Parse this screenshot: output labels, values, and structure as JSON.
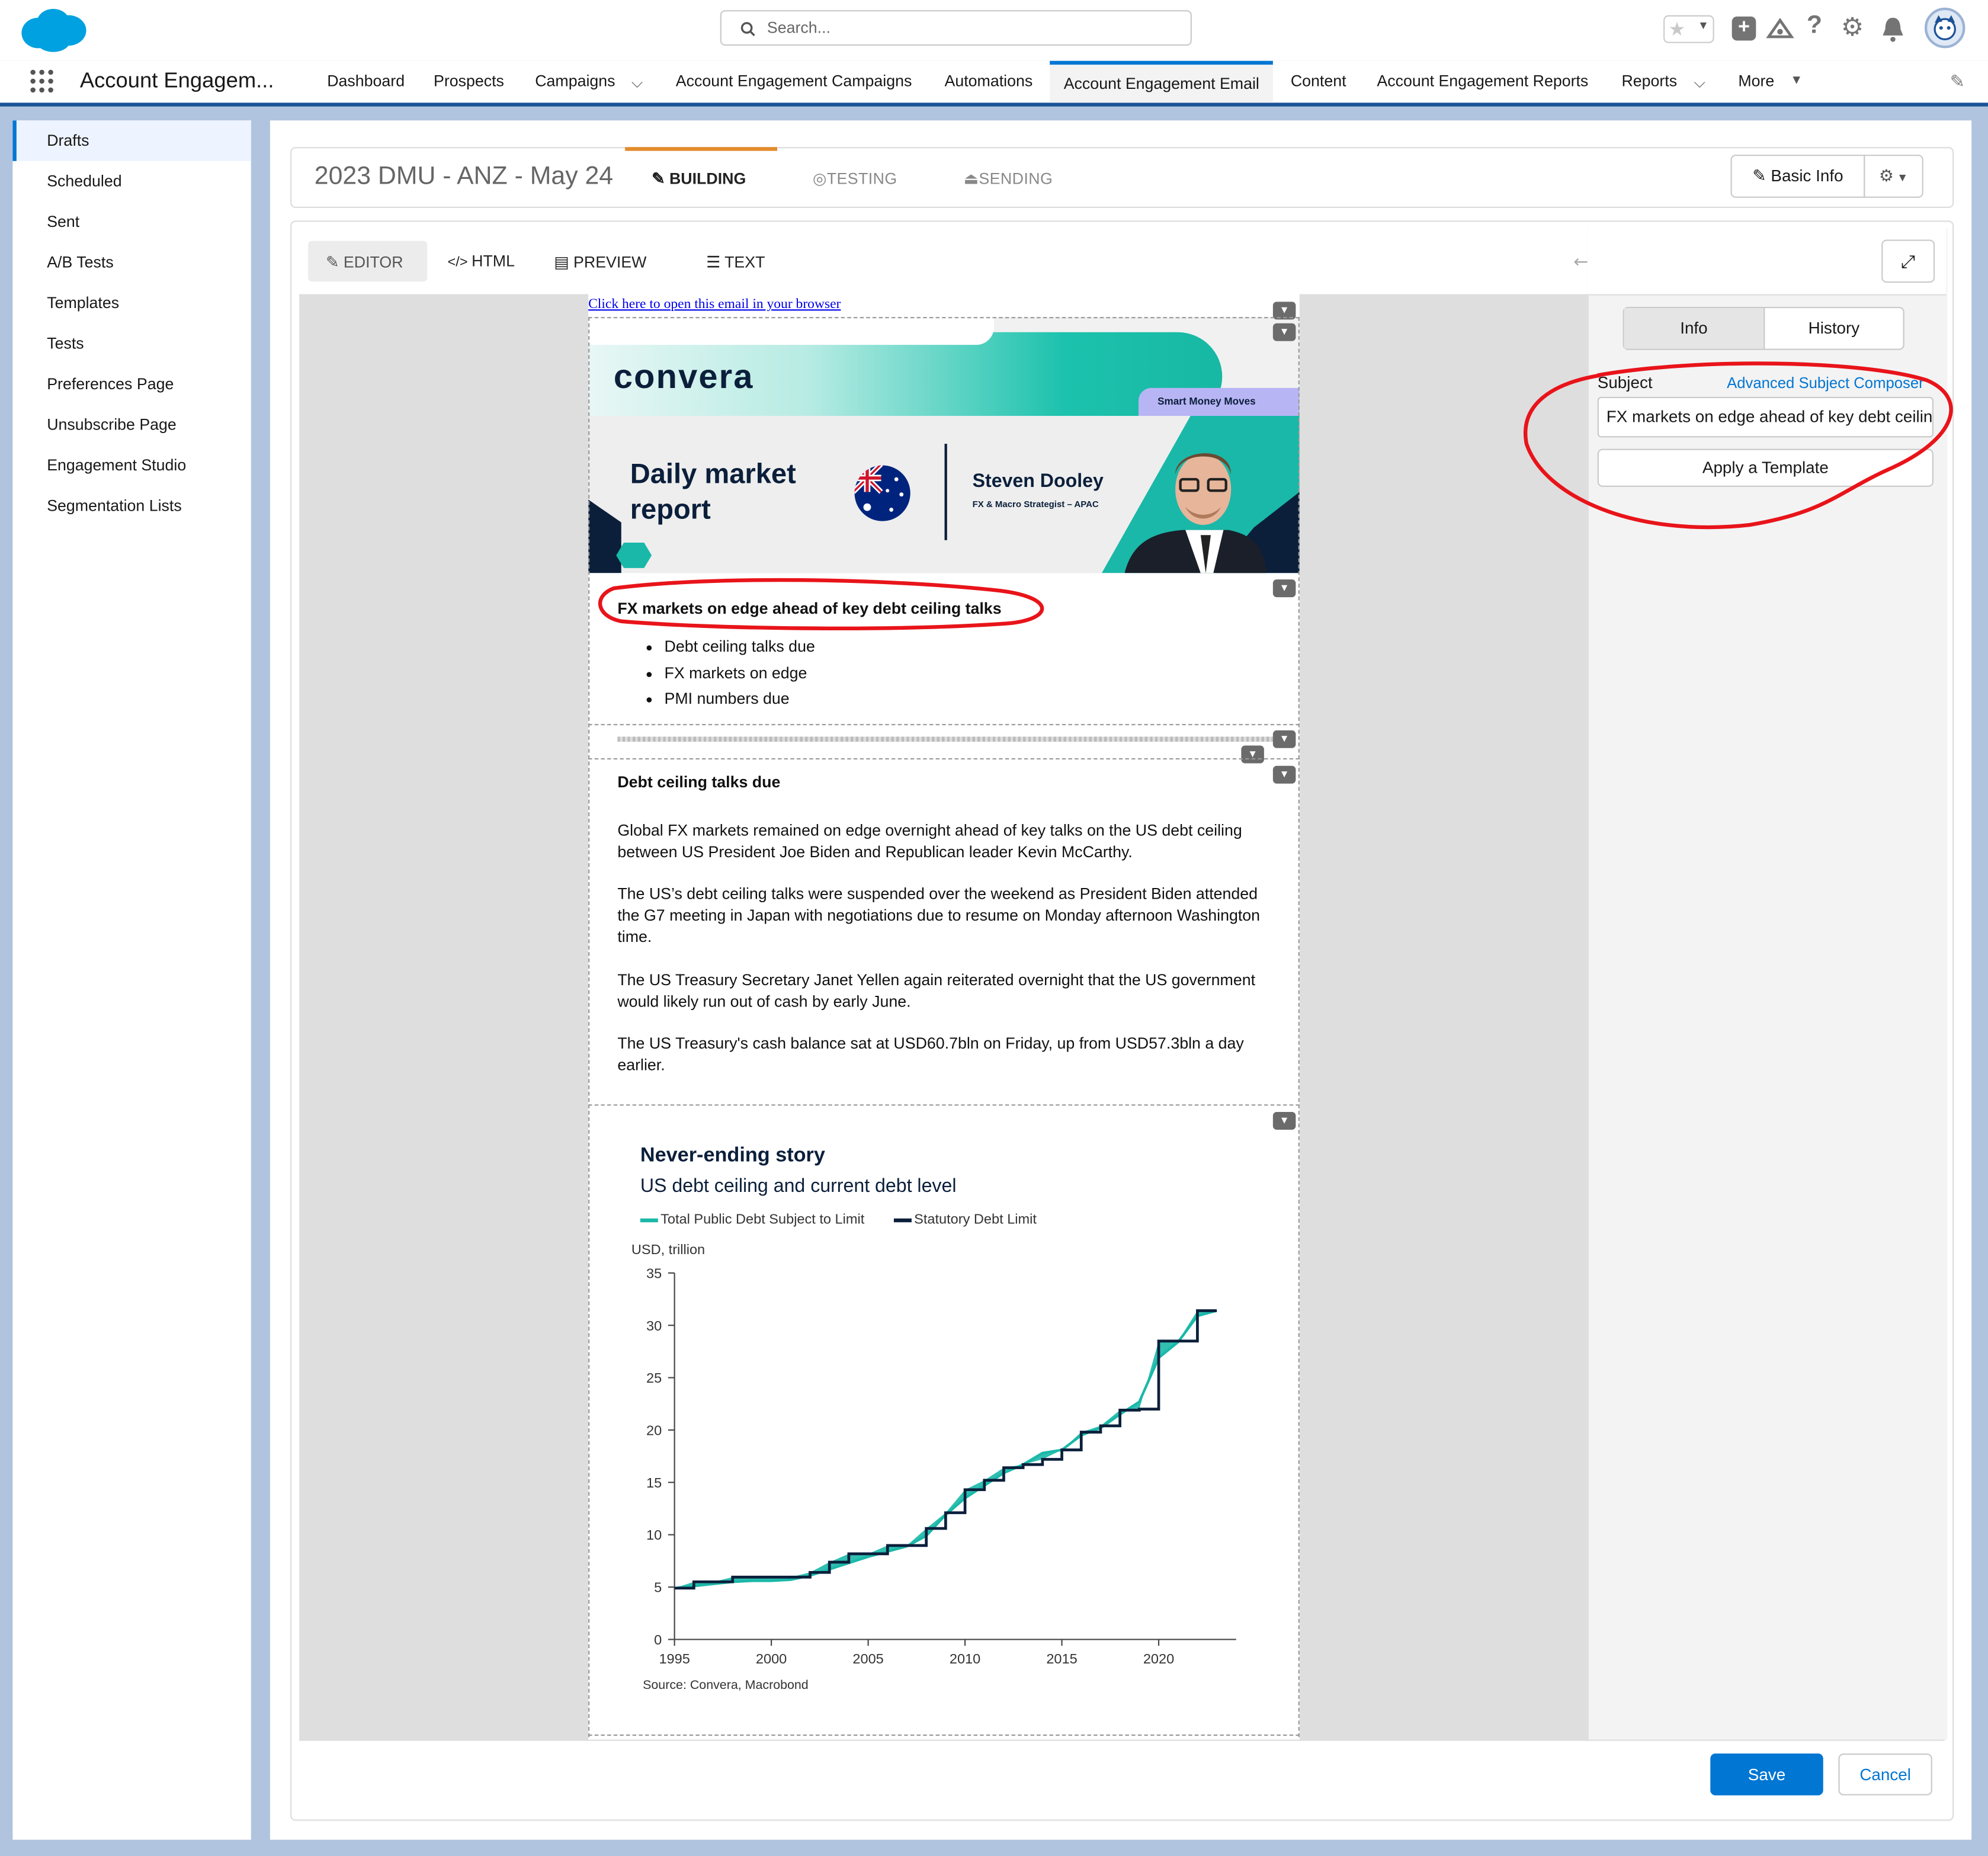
{
  "global": {
    "search_placeholder": "Search..."
  },
  "nav": {
    "app_name": "Account Engagem...",
    "items": [
      "Dashboard",
      "Prospects",
      "Campaigns",
      "Account Engagement Campaigns",
      "Automations",
      "Account Engagement Email",
      "Content",
      "Account Engagement Reports",
      "Reports",
      "More"
    ]
  },
  "sidebar": {
    "items": [
      "Drafts",
      "Scheduled",
      "Sent",
      "A/B Tests",
      "Templates",
      "Tests",
      "Preferences Page",
      "Unsubscribe Page",
      "Engagement Studio",
      "Segmentation Lists"
    ]
  },
  "email_header": {
    "title": "2023 DMU - ANZ - May 24",
    "stages": [
      "BUILDING",
      "TESTING",
      "SENDING"
    ],
    "basic_info": "Basic Info"
  },
  "editor": {
    "tabs": [
      "EDITOR",
      "HTML",
      "PREVIEW",
      "TEXT"
    ]
  },
  "email": {
    "browser_link": "Click here to open this email in your browser",
    "brand": "convera",
    "tagline": "Smart Money Moves",
    "banner_title_1": "Daily market",
    "banner_title_2": "report",
    "author_name": "Steven Dooley",
    "author_role": "FX & Macro Strategist – APAC",
    "headline": "FX markets on edge ahead of key debt ceiling talks",
    "bullets": [
      "Debt ceiling talks due",
      "FX markets on edge",
      "PMI numbers due"
    ],
    "section_title": "Debt ceiling talks due",
    "paragraphs": [
      "Global FX markets remained on edge overnight ahead of key talks on the US debt ceiling between US President Joe Biden and Republican leader Kevin McCarthy.",
      "The US’s debt ceiling talks were suspended over the weekend as President Biden attended the G7 meeting in Japan with negotiations due to resume on Monday afternoon Washington time.",
      "The US Treasury Secretary Janet Yellen again reiterated overnight that the US government would likely run out of cash by early June.",
      "The US Treasury's cash balance sat at USD60.7bln on Friday, up from USD57.3bln a day earlier."
    ]
  },
  "right_panel": {
    "tabs": [
      "Info",
      "History"
    ],
    "subject_label": "Subject",
    "advanced_link": "Advanced Subject Composer",
    "subject_value": "FX markets on edge ahead of key debt ceiling talks",
    "apply_template": "Apply a Template"
  },
  "footer": {
    "save": "Save",
    "cancel": "Cancel"
  },
  "colors": {
    "brand_blue": "#0176d3",
    "teal": "#1ab8a8",
    "navy": "#0b1f3b",
    "annotation_red": "#e8141a"
  },
  "chart_data": {
    "type": "line",
    "title": "Never-ending story",
    "subtitle": "US debt ceiling and current debt level",
    "ylabel": "USD, trillion",
    "xlabel": "",
    "xlim": [
      1995,
      2024
    ],
    "ylim": [
      0,
      35
    ],
    "x_ticks": [
      1995,
      2000,
      2005,
      2010,
      2015,
      2020
    ],
    "y_ticks": [
      0,
      5,
      10,
      15,
      20,
      25,
      30,
      35
    ],
    "source": "Source: Convera, Macrobond",
    "legend_position": "top",
    "series": [
      {
        "name": "Total Public Debt Subject to Limit",
        "color": "#1ab8a8",
        "x": [
          1995,
          1996,
          1997,
          1998,
          1999,
          2000,
          2001,
          2002,
          2003,
          2004,
          2005,
          2006,
          2007,
          2008,
          2009,
          2010,
          2011,
          2012,
          2013,
          2014,
          2015,
          2016,
          2017,
          2018,
          2019,
          2020,
          2021,
          2022,
          2023
        ],
        "y": [
          4.9,
          5.1,
          5.3,
          5.5,
          5.6,
          5.6,
          5.7,
          6.1,
          6.7,
          7.3,
          7.9,
          8.4,
          8.9,
          9.9,
          11.9,
          13.5,
          14.7,
          15.9,
          16.7,
          17.8,
          18.1,
          19.5,
          20.2,
          21.5,
          22.7,
          26.9,
          28.4,
          30.9,
          31.4
        ]
      },
      {
        "name": "Statutory Debt Limit",
        "color": "#0b1f3b",
        "x": [
          1995,
          1996,
          1997,
          1998,
          1999,
          2000,
          2001,
          2002,
          2003,
          2004,
          2005,
          2006,
          2007,
          2008,
          2009,
          2010,
          2011,
          2012,
          2013,
          2014,
          2015,
          2016,
          2017,
          2018,
          2019,
          2020,
          2021,
          2022,
          2023
        ],
        "y": [
          4.9,
          5.5,
          5.5,
          5.95,
          5.95,
          5.95,
          5.95,
          6.4,
          7.38,
          8.18,
          8.18,
          8.97,
          8.97,
          10.6,
          12.1,
          14.3,
          15.2,
          16.4,
          16.7,
          17.2,
          18.1,
          19.8,
          20.4,
          21.9,
          22.0,
          28.5,
          28.5,
          31.4,
          31.4
        ]
      }
    ]
  }
}
